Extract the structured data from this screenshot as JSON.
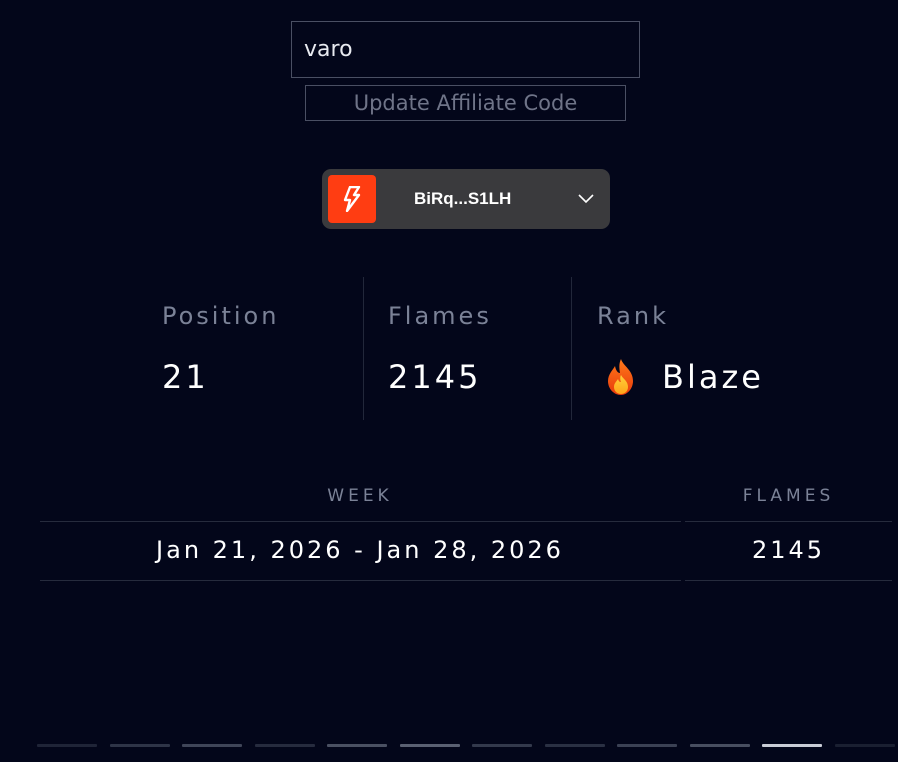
{
  "affiliate": {
    "code_value": "varo",
    "update_label": "Update Affiliate Code"
  },
  "wallet": {
    "address_short": "BiRq...S1LH",
    "logo_icon": "bolt-icon",
    "brand_color": "#ff3d12",
    "dropdown_icon": "chevron-down-icon"
  },
  "stats": {
    "position_label": "Position",
    "position_value": "21",
    "flames_label": "Flames",
    "flames_value": "2145",
    "rank_label": "Rank",
    "rank_value": "Blaze",
    "rank_icon": "fire-icon"
  },
  "table": {
    "headers": [
      "WEEK",
      "FLAMES"
    ],
    "rows": [
      {
        "week": "Jan 21, 2026 - Jan 28, 2026",
        "flames": "2145"
      }
    ]
  },
  "pager": {
    "count": 12,
    "active_index": 10
  }
}
